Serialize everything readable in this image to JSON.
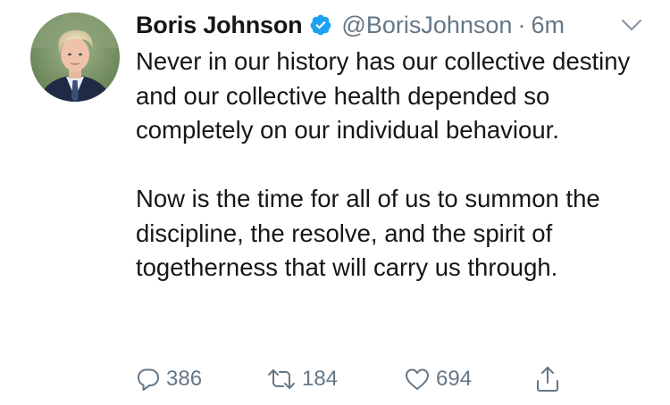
{
  "author": {
    "name": "Boris Johnson",
    "handle": "@BorisJohnson",
    "separator": "·",
    "time": "6m",
    "verified": true
  },
  "tweet": {
    "paragraphs": [
      "Never in our history has our collective destiny and our collective health depended so completely on our individual behaviour.",
      "Now is the time for all of us to summon the discipline, the resolve, and the spirit of togetherness that will carry us through."
    ]
  },
  "actions": {
    "replies": "386",
    "retweets": "184",
    "likes": "694"
  },
  "icons": {
    "reply": "reply-icon",
    "retweet": "retweet-icon",
    "like": "heart-icon",
    "share": "share-icon",
    "verified": "verified-badge-icon",
    "menu": "chevron-down-icon"
  },
  "colors": {
    "text": "#14171a",
    "secondary": "#657786",
    "verified_blue": "#1da1f2"
  }
}
